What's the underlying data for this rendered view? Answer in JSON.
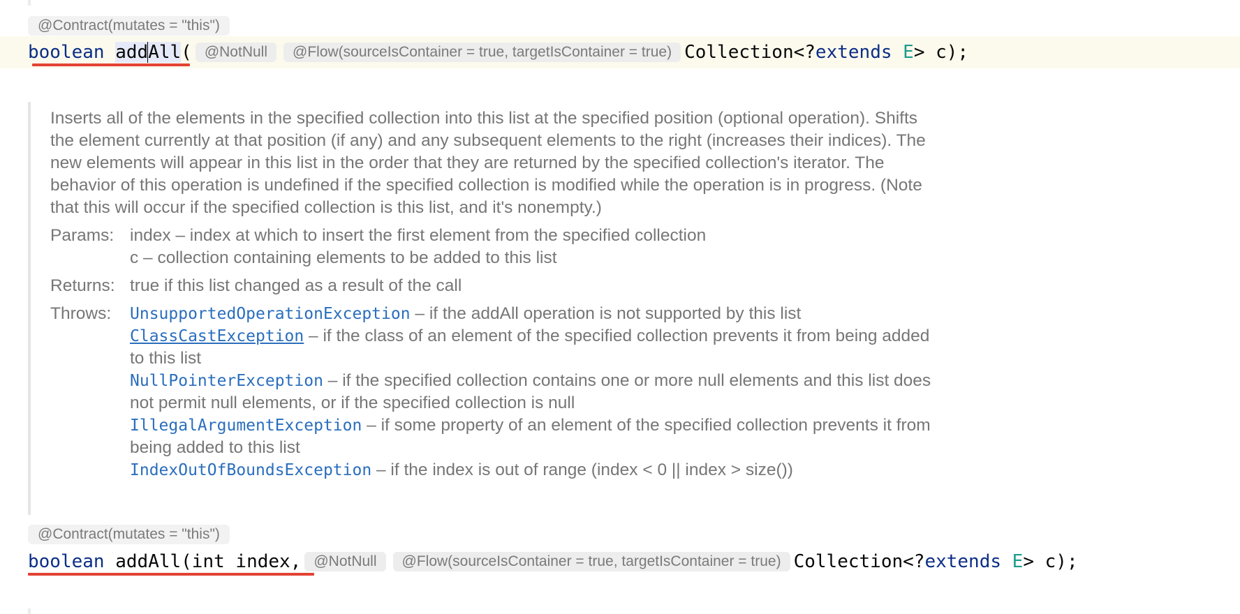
{
  "first_signature": {
    "contract_hint": "@Contract(mutates = \"this\")",
    "return_type": "boolean",
    "method_sel_a": "add",
    "method_sel_b": "All",
    "open_paren": "(",
    "notnull_hint": "@NotNull",
    "flow_hint": "@Flow(sourceIsContainer = true, targetIsContainer = true)",
    "param_type_start": "Collection<? ",
    "extends_kw": "extends",
    "type_param": "E",
    "param_end": "> c);"
  },
  "doc": {
    "description": "Inserts all of the elements in the specified collection into this list at the specified position (optional operation). Shifts the element currently at that position (if any) and any subsequent elements to the right (increases their indices). The new elements will appear in this list in the order that they are returned by the specified collection's iterator. The behavior of this operation is undefined if the specified collection is modified while the operation is in progress. (Note that this will occur if the specified collection is this list, and it's nonempty.)",
    "params_label": "Params:",
    "params": [
      "index – index at which to insert the first element from the specified collection",
      "c – collection containing elements to be added to this list"
    ],
    "returns_label": "Returns:",
    "returns": "true if this list changed as a result of the call",
    "throws_label": "Throws:",
    "throws": [
      {
        "exception": "UnsupportedOperationException",
        "text": " – if the addAll operation is not supported by this list"
      },
      {
        "exception": "ClassCastException",
        "text": " – if the class of an element of the specified collection prevents it from being added to this list"
      },
      {
        "exception": "NullPointerException",
        "text": " – if the specified collection contains one or more null elements and this list does not permit null elements, or if the specified collection is null"
      },
      {
        "exception": "IllegalArgumentException",
        "text": " – if some property of an element of the specified collection prevents it from being added to this list"
      },
      {
        "exception": "IndexOutOfBoundsException",
        "text": " – if the index is out of range (index < 0 || index > size())"
      }
    ]
  },
  "second_signature": {
    "contract_hint": "@Contract(mutates = \"this\")",
    "return_type": "boolean",
    "method_params": "addAll(int index,",
    "notnull_hint": "@NotNull",
    "flow_hint": "@Flow(sourceIsContainer = true, targetIsContainer = true)",
    "param_type_start": "Collection<? ",
    "extends_kw": "extends",
    "type_param": "E",
    "param_end": "> c);"
  },
  "colors": {
    "keyword": "#0b2e86",
    "type_param": "#1a9c8c",
    "link": "#2a6ebd",
    "error_underline": "#e34234",
    "current_line": "#fcfaed",
    "bulb": "#f1a90a"
  }
}
